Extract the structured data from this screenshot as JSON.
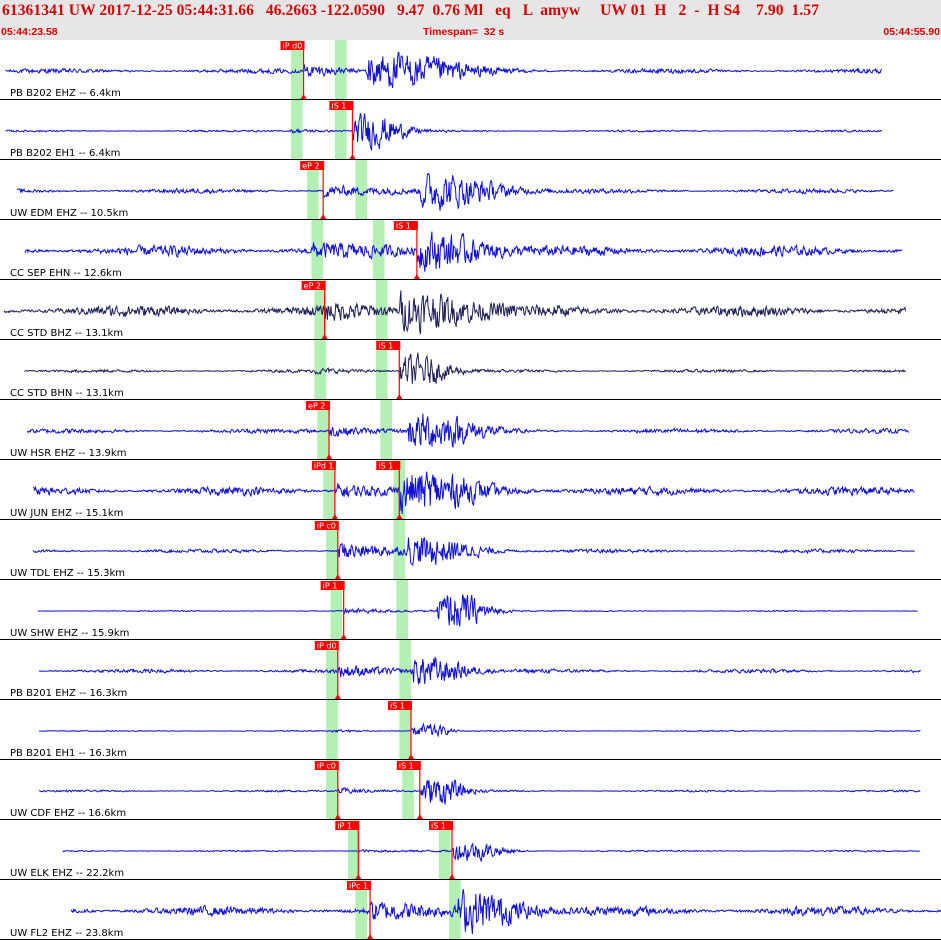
{
  "header": {
    "title": "61361341 UW 2017-12-25 05:44:31.66   46.2663 -122.0590   9.47  0.76 Ml   eq   L  amyw     UW 01  H   2  -  H S4    7.90  1.57",
    "start_time": "05:44:23.58",
    "timespan": "Timespan=  32 s",
    "end_time": "05:44:55.90"
  },
  "colors": {
    "trace": "#1010d0",
    "trace_dark": "#20205a",
    "pick": "#ff0000",
    "window": "#b4f0b4",
    "divider": "#000000",
    "header_bg": "#e6e6e6",
    "header_text": "#d40000"
  },
  "traces": [
    {
      "label": "PB B202 EHZ -- 6.4km",
      "color": "trace",
      "p": {
        "tag": "iP d0",
        "t": 10.23
      },
      "s": {
        "tag": "",
        "t": 12.38
      },
      "wp": [
        9.8,
        10.2
      ],
      "ws": [
        11.3,
        11.7
      ],
      "start": 0.05,
      "end": 30.0,
      "noise": 0.12,
      "p_amp": 0.3,
      "s_amp": 0.85,
      "dur": 6.0
    },
    {
      "label": "PB B202 EH1 -- 6.4km",
      "color": "trace",
      "p": {
        "tag": "",
        "t": 9.8
      },
      "s": {
        "tag": "iS 1",
        "t": 11.9
      },
      "wp": [
        9.8,
        10.2
      ],
      "ws": [
        11.3,
        11.7
      ],
      "start": 0.05,
      "end": 30.0,
      "noise": 0.05,
      "p_amp": 0.1,
      "s_amp": 0.85,
      "dur": 2.5
    },
    {
      "label": "UW EDM EHZ -- 10.5km",
      "color": "trace",
      "p": {
        "tag": "eP 2",
        "t": 10.9
      },
      "s": {
        "tag": "",
        "t": 14.2
      },
      "wp": [
        10.35,
        10.75
      ],
      "ws": [
        12.0,
        12.4
      ],
      "start": 0.45,
      "end": 30.4,
      "noise": 0.12,
      "p_amp": 0.3,
      "s_amp": 0.85,
      "dur": 5.0
    },
    {
      "label": "CC SEP EHN -- 12.6km",
      "color": "trace",
      "p": {
        "tag": "",
        "t": 10.5
      },
      "s": {
        "tag": "iS 1",
        "t": 14.1
      },
      "wp": [
        10.5,
        10.9
      ],
      "ws": [
        12.6,
        13.0
      ],
      "start": 0.7,
      "end": 30.7,
      "noise": 0.28,
      "p_amp": 0.3,
      "s_amp": 0.85,
      "dur": 4.5
    },
    {
      "label": "CC STD BHZ -- 13.1km",
      "color": "trace_dark",
      "p": {
        "tag": "eP 2",
        "t": 10.95
      },
      "s": {
        "tag": "",
        "t": 13.5
      },
      "wp": [
        10.6,
        11.0
      ],
      "ws": [
        12.7,
        13.1
      ],
      "start": 0.0,
      "end": 30.8,
      "noise": 0.3,
      "p_amp": 0.3,
      "s_amp": 0.9,
      "dur": 5.0
    },
    {
      "label": "CC STD BHN -- 13.1km",
      "color": "trace_dark",
      "p": {
        "tag": "",
        "t": 10.6
      },
      "s": {
        "tag": "iS 1",
        "t": 13.5
      },
      "wp": [
        10.6,
        11.0
      ],
      "ws": [
        12.7,
        13.1
      ],
      "start": 0.7,
      "end": 30.8,
      "noise": 0.08,
      "p_amp": 0.1,
      "s_amp": 0.8,
      "dur": 2.5
    },
    {
      "label": "UW HSR EHZ -- 13.9km",
      "color": "trace",
      "p": {
        "tag": "eP 2",
        "t": 11.1
      },
      "s": {
        "tag": "",
        "t": 13.8
      },
      "wp": [
        10.7,
        11.1
      ],
      "ws": [
        12.85,
        13.25
      ],
      "start": 0.8,
      "end": 30.9,
      "noise": 0.12,
      "p_amp": 0.3,
      "s_amp": 0.85,
      "dur": 4.0
    },
    {
      "label": "UW JUN EHZ -- 15.1km",
      "color": "trace",
      "p": {
        "tag": "iPd 1",
        "t": 11.3
      },
      "s": {
        "tag": "iS 1",
        "t": 13.5
      },
      "wp": [
        10.9,
        11.3
      ],
      "ws": [
        13.3,
        13.7
      ],
      "start": 1.0,
      "end": 31.1,
      "noise": 0.22,
      "p_amp": 0.4,
      "s_amp": 0.85,
      "dur": 5.0
    },
    {
      "label": "UW TDL EHZ -- 15.3km",
      "color": "trace",
      "p": {
        "tag": "iP c0",
        "t": 11.4
      },
      "s": {
        "tag": "",
        "t": 13.8
      },
      "wp": [
        11.0,
        11.4
      ],
      "ws": [
        13.3,
        13.7
      ],
      "start": 1.0,
      "end": 31.1,
      "noise": 0.1,
      "p_amp": 0.5,
      "s_amp": 0.6,
      "dur": 4.0
    },
    {
      "label": "UW SHW EHZ -- 15.9km",
      "color": "trace",
      "p": {
        "tag": "iP 1",
        "t": 11.6
      },
      "s": {
        "tag": "",
        "t": 14.8
      },
      "wp": [
        11.15,
        11.55
      ],
      "ws": [
        13.4,
        13.8
      ],
      "start": 1.15,
      "end": 31.2,
      "noise": 0.03,
      "p_amp": 0.15,
      "s_amp": 0.95,
      "dur": 2.5
    },
    {
      "label": "PB B201 EHZ -- 16.3km",
      "color": "trace",
      "p": {
        "tag": "iP d0",
        "t": 11.4
      },
      "s": {
        "tag": "",
        "t": 13.9
      },
      "wp": [
        11.0,
        11.4
      ],
      "ws": [
        13.5,
        13.9
      ],
      "start": 1.2,
      "end": 31.3,
      "noise": 0.1,
      "p_amp": 0.3,
      "s_amp": 0.7,
      "dur": 3.0
    },
    {
      "label": "PB B201 EH1 -- 16.3km",
      "color": "trace",
      "p": {
        "tag": "",
        "t": 11.2
      },
      "s": {
        "tag": "iS 1",
        "t": 13.9
      },
      "wp": [
        11.0,
        11.4
      ],
      "ws": [
        13.5,
        13.9
      ],
      "start": 1.2,
      "end": 31.3,
      "noise": 0.03,
      "p_amp": 0.05,
      "s_amp": 0.35,
      "dur": 1.5
    },
    {
      "label": "UW CDF EHZ -- 16.6km",
      "color": "trace",
      "p": {
        "tag": "iP c0",
        "t": 11.4
      },
      "s": {
        "tag": "iS 1",
        "t": 14.2
      },
      "wp": [
        11.0,
        11.4
      ],
      "ws": [
        13.6,
        14.0
      ],
      "start": 1.2,
      "end": 31.3,
      "noise": 0.05,
      "p_amp": 0.15,
      "s_amp": 0.7,
      "dur": 2.0
    },
    {
      "label": "UW ELK EHZ -- 22.2km",
      "color": "trace",
      "p": {
        "tag": "iP 1",
        "t": 12.1
      },
      "s": {
        "tag": "iS 1",
        "t": 15.3
      },
      "wp": [
        11.75,
        12.15
      ],
      "ws": [
        14.85,
        15.25
      ],
      "start": 2.0,
      "end": 31.3,
      "noise": 0.04,
      "p_amp": 0.08,
      "s_amp": 0.5,
      "dur": 2.5
    },
    {
      "label": "UW FL2 EHZ -- 23.8km",
      "color": "trace",
      "p": {
        "tag": "iPc 1",
        "t": 12.5
      },
      "s": {
        "tag": "",
        "t": 15.5
      },
      "wp": [
        12.0,
        12.4
      ],
      "ws": [
        15.2,
        15.6
      ],
      "start": 2.3,
      "end": 32.3,
      "noise": 0.25,
      "p_amp": 0.4,
      "s_amp": 0.9,
      "dur": 4.0
    }
  ]
}
